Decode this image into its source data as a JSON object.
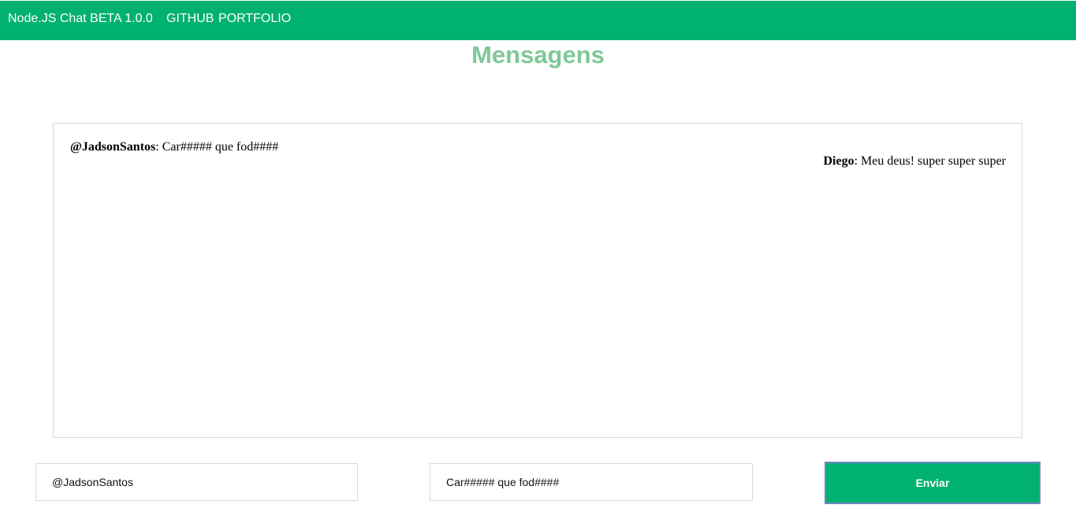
{
  "colors": {
    "accent": "#00b171",
    "title": "#7fc897"
  },
  "navbar": {
    "brand": "Node.JS Chat BETA 1.0.0",
    "links": [
      "GITHUB",
      "PORTFOLIO"
    ]
  },
  "title": "Mensagens",
  "messages": [
    {
      "author": "@JadsonSantos",
      "separator": ": ",
      "text": "Car##### que fod####"
    },
    {
      "author": "Diego",
      "separator": ": ",
      "text": "Meu deus! super super super"
    }
  ],
  "form": {
    "username_value": "@JadsonSantos",
    "message_value": "Car##### que fod####",
    "send_label": "Enviar"
  }
}
